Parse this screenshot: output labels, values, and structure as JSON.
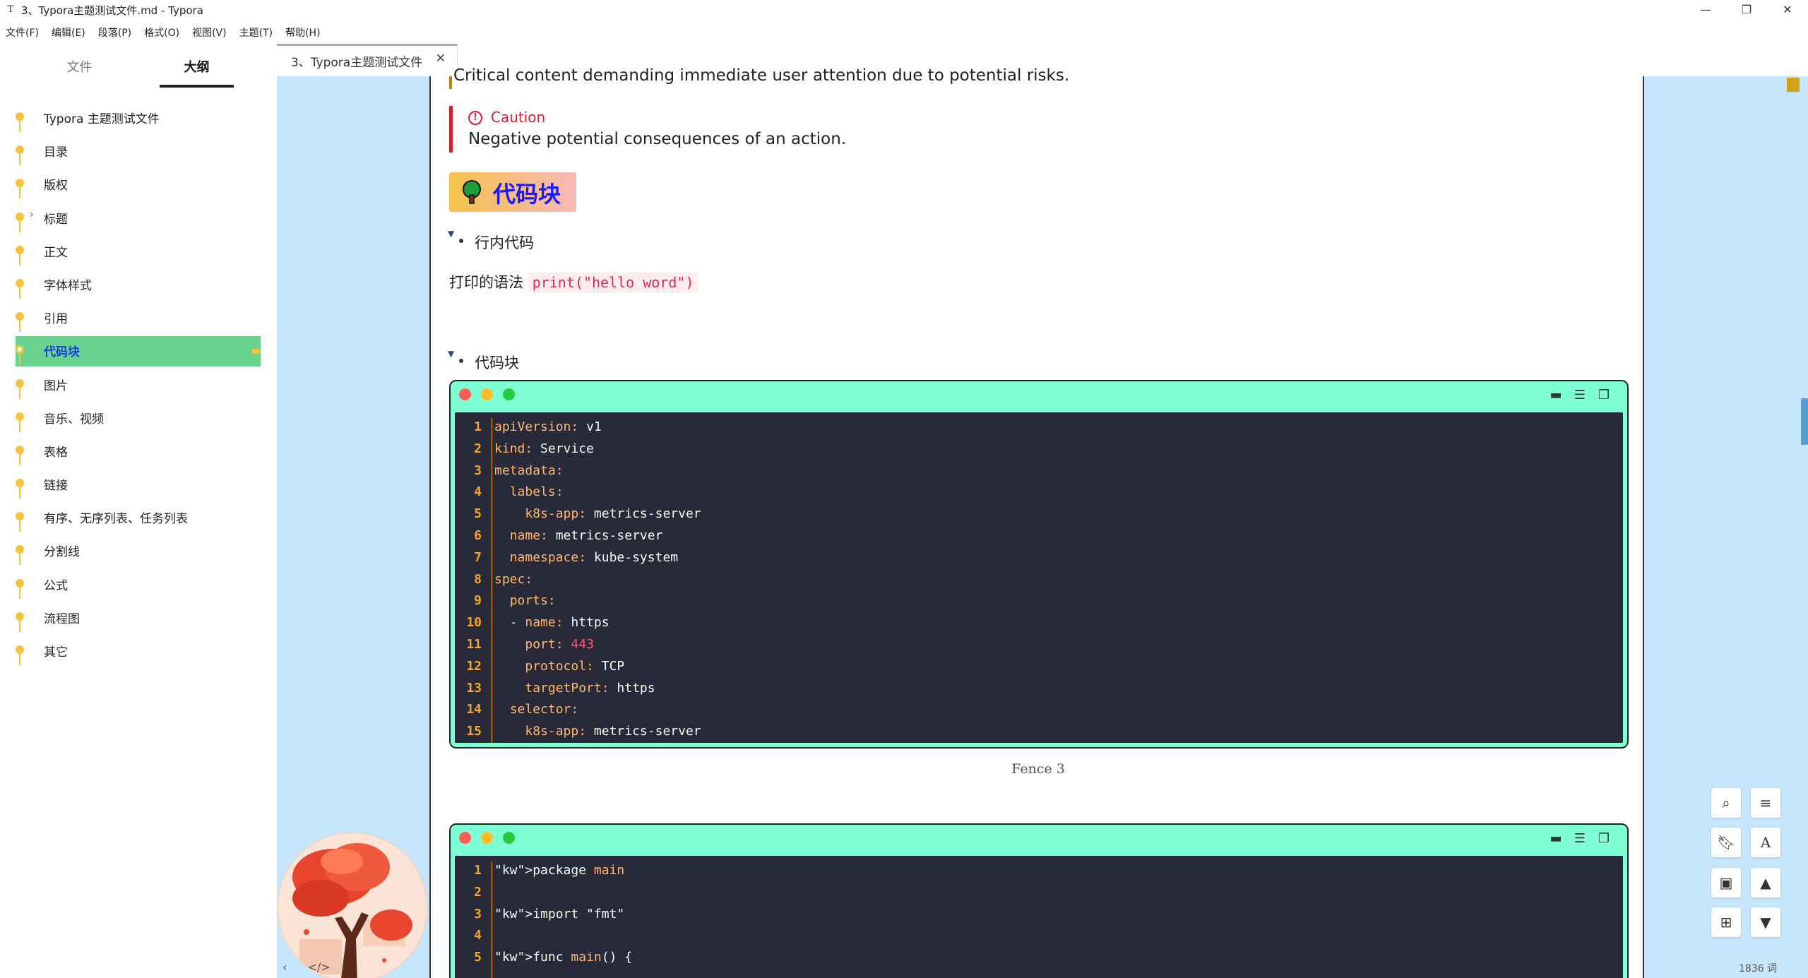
{
  "window": {
    "title": "3、Typora主题测试文件.md - Typora",
    "app_icon": "T",
    "minimize": "—",
    "maximize": "❐",
    "close": "✕"
  },
  "menu": [
    "文件(F)",
    "编辑(E)",
    "段落(P)",
    "格式(O)",
    "视图(V)",
    "主题(T)",
    "帮助(H)"
  ],
  "sidebar": {
    "tabs": {
      "files": "文件",
      "outline": "大纲"
    },
    "outline": [
      {
        "label": "Typora 主题测试文件",
        "expandable": false,
        "active": false
      },
      {
        "label": "目录",
        "expandable": false,
        "active": false
      },
      {
        "label": "版权",
        "expandable": false,
        "active": false
      },
      {
        "label": "标题",
        "expandable": true,
        "active": false
      },
      {
        "label": "正文",
        "expandable": false,
        "active": false
      },
      {
        "label": "字体样式",
        "expandable": false,
        "active": false
      },
      {
        "label": "引用",
        "expandable": false,
        "active": false
      },
      {
        "label": "代码块",
        "expandable": false,
        "active": true
      },
      {
        "label": "图片",
        "expandable": false,
        "active": false
      },
      {
        "label": "音乐、视频",
        "expandable": false,
        "active": false
      },
      {
        "label": "表格",
        "expandable": false,
        "active": false
      },
      {
        "label": "链接",
        "expandable": false,
        "active": false
      },
      {
        "label": "有序、无序列表、任务列表",
        "expandable": false,
        "active": false
      },
      {
        "label": "分割线",
        "expandable": false,
        "active": false
      },
      {
        "label": "公式",
        "expandable": false,
        "active": false
      },
      {
        "label": "流程图",
        "expandable": false,
        "active": false
      },
      {
        "label": "其它",
        "expandable": false,
        "active": false
      }
    ],
    "bottom_left": "‹",
    "bottom_code": "</>"
  },
  "tab": {
    "label": "3、Typora主题测试文件",
    "close": "✕"
  },
  "document": {
    "cut_line": "Critical content demanding immediate user attention due to potential risks.",
    "caution": {
      "icon": "!",
      "title": "Caution",
      "text": "Negative potential consequences of an action."
    },
    "heading": "代码块",
    "bullet_inline": "行内代码",
    "inline_prefix": "打印的语法",
    "inline_code": "print(\"hello word\")",
    "bullet_block": "代码块",
    "fence1_caption": "Fence 3",
    "fence1_lines": [
      "apiVersion: v1",
      "kind: Service",
      "metadata:",
      "  labels:",
      "    k8s-app: metrics-server",
      "  name: metrics-server",
      "  namespace: kube-system",
      "spec:",
      "  ports:",
      "  - name: https",
      "    port: 443",
      "    protocol: TCP",
      "    targetPort: https",
      "  selector:",
      "    k8s-app: metrics-server"
    ],
    "fence2_lines": [
      "package main",
      "",
      "import \"fmt\"",
      "",
      "func main() {"
    ]
  },
  "colors": {
    "accent_yellow": "#f7c23b",
    "active_green": "#6ad28f",
    "editor_bg": "#c6e6fb",
    "code_frame": "#7fffd4",
    "code_bg": "#282a3a",
    "caution_red": "#cf222e"
  },
  "status": {
    "word_count": "1836 词"
  }
}
